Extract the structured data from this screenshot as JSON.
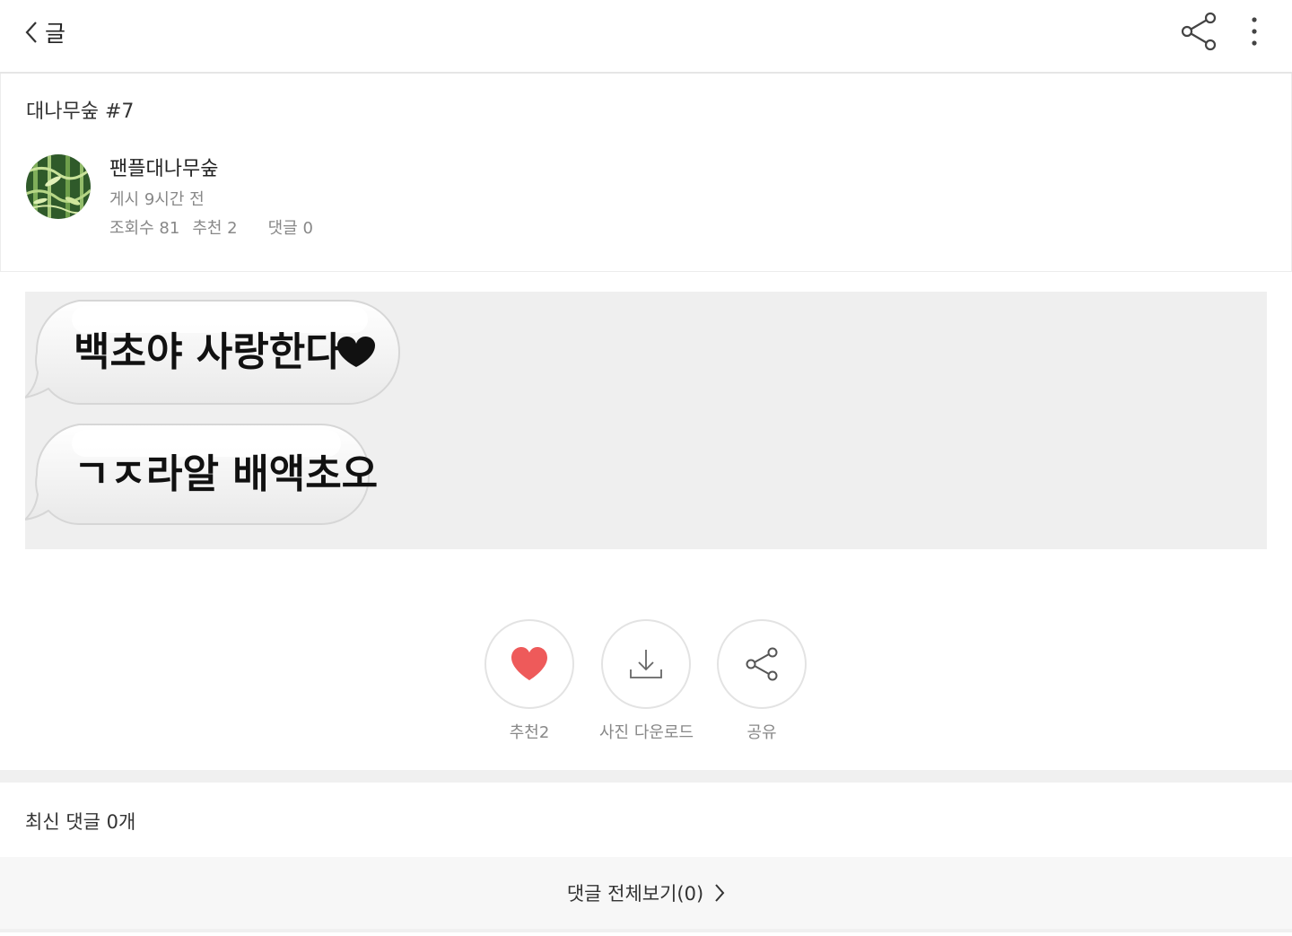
{
  "header": {
    "back_title": "글"
  },
  "post": {
    "board_title": "대나무숲 #7",
    "author": "팬플대나무숲",
    "posted": "게시 9시간 전",
    "views": "조회수 81",
    "likes": "추천 2",
    "comments": "댓글 0",
    "image_lines": [
      "백초야 사랑한다",
      "ㄱㅈ라알 배액초오"
    ]
  },
  "actions": {
    "like_label": "추천2",
    "download_label": "사진 다운로드",
    "share_label": "공유"
  },
  "comments_section": {
    "title": "최신 댓글 0개",
    "view_all": "댓글 전체보기(0)"
  },
  "colors": {
    "heart": "#ee5a5a",
    "icon": "#555555",
    "divider": "#f0f0f0"
  }
}
